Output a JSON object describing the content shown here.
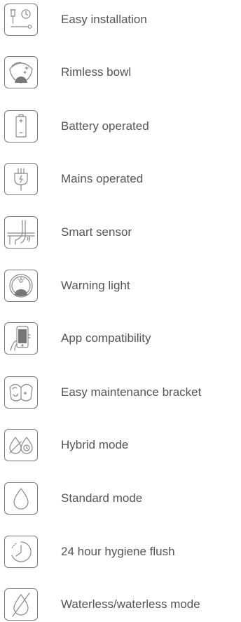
{
  "features": [
    {
      "icon": "tools-icon",
      "label": "Easy installation"
    },
    {
      "icon": "rimless-bowl-icon",
      "label": "Rimless bowl"
    },
    {
      "icon": "battery-icon",
      "label": "Battery operated"
    },
    {
      "icon": "power-plug-icon",
      "label": "Mains operated"
    },
    {
      "icon": "sensor-icon",
      "label": "Smart sensor"
    },
    {
      "icon": "warning-light-icon",
      "label": "Warning light"
    },
    {
      "icon": "smartphone-icon",
      "label": "App compatibility"
    },
    {
      "icon": "bracket-icon",
      "label": "Easy maintenance bracket"
    },
    {
      "icon": "hybrid-drop-icon",
      "label": "Hybrid mode"
    },
    {
      "icon": "water-drop-icon",
      "label": "Standard mode"
    },
    {
      "icon": "clock-flush-icon",
      "label": "24 hour hygiene flush"
    },
    {
      "icon": "no-water-drop-icon",
      "label": "Waterless/waterless mode"
    }
  ]
}
